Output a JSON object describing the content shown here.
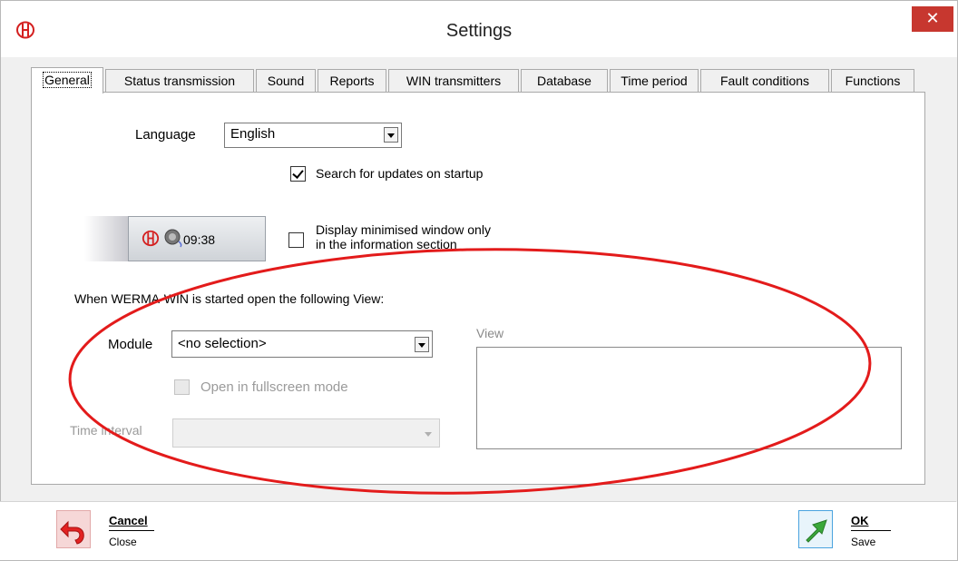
{
  "window": {
    "title": "Settings",
    "close_glyph": "✕"
  },
  "tabs": [
    {
      "label": "General",
      "active": true
    },
    {
      "label": "Status transmission"
    },
    {
      "label": "Sound"
    },
    {
      "label": "Reports"
    },
    {
      "label": "WIN transmitters"
    },
    {
      "label": "Database"
    },
    {
      "label": "Time period"
    },
    {
      "label": "Fault conditions"
    },
    {
      "label": "Functions"
    }
  ],
  "general": {
    "language_label": "Language",
    "language_value": "English",
    "search_updates_label": "Search for updates on startup",
    "search_updates_checked": true,
    "taskbar_time": "09:38",
    "minimised_label_line1": "Display minimised window only",
    "minimised_label_line2": "in the information section",
    "minimised_checked": false,
    "startup_view_heading": "When WERMA-WIN is started open the following View:",
    "module_label": "Module",
    "module_value": "<no selection>",
    "fullscreen_label": "Open in fullscreen mode",
    "fullscreen_checked": false,
    "time_interval_label": "Time interval",
    "time_interval_value": "",
    "view_label": "View"
  },
  "footer": {
    "cancel_title": "Cancel",
    "cancel_sub": "Close",
    "ok_title": "OK",
    "ok_sub": "Save"
  },
  "icons": {
    "app": "werma-logo-icon",
    "taskbar_app": "werma-logo-icon",
    "taskbar_sound": "speaker-icon",
    "cancel": "undo-arrow-icon",
    "ok": "green-arrow-icon"
  },
  "colors": {
    "close_button": "#c7372f",
    "annotation_ellipse": "#e31b1b",
    "werma_red": "#d42020",
    "ok_green": "#3aa83a"
  }
}
